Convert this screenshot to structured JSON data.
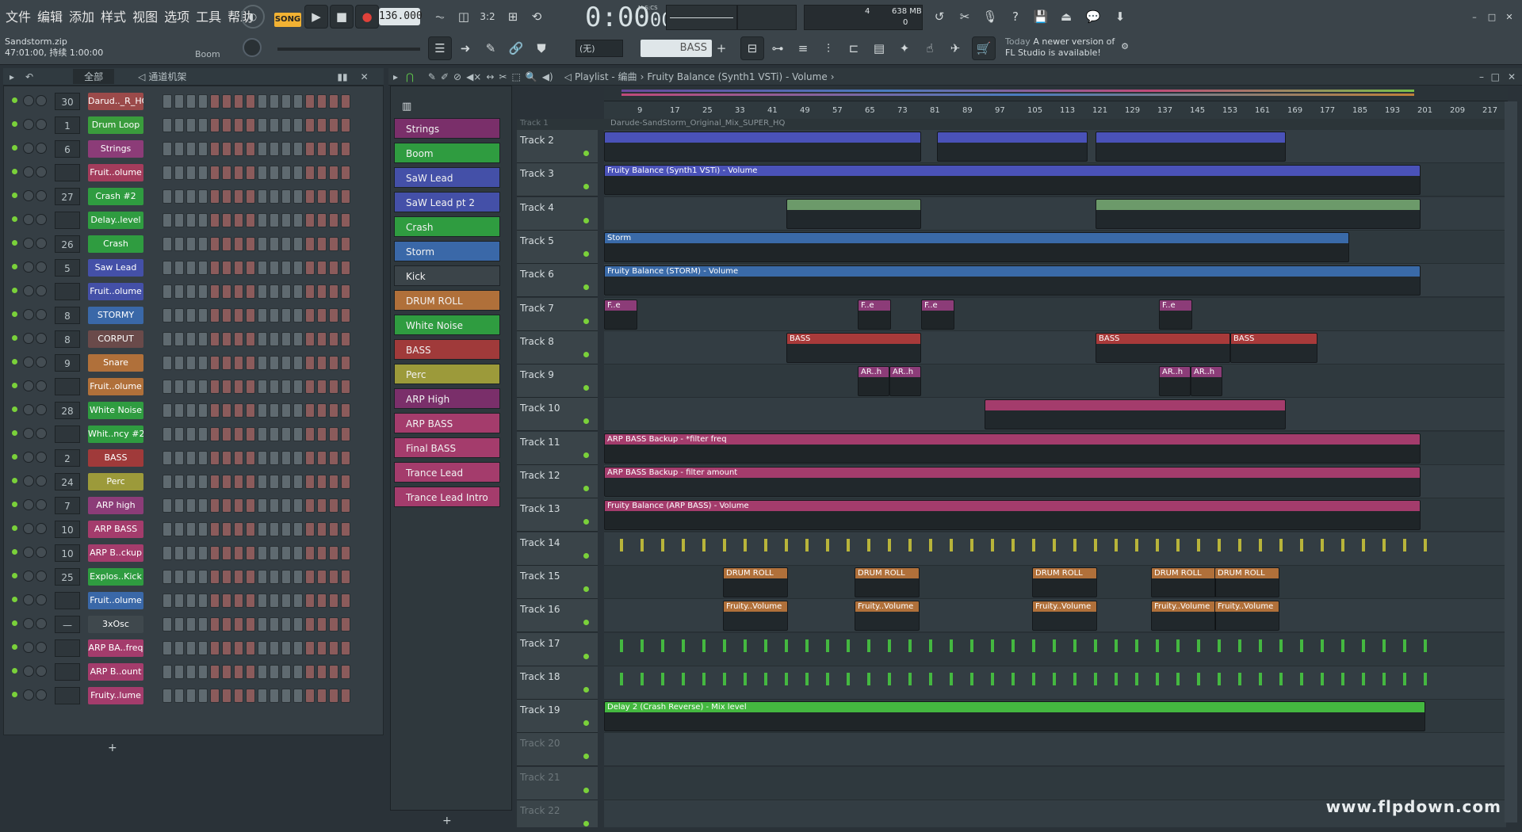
{
  "menu": [
    "文件",
    "编辑",
    "添加",
    "样式",
    "视图",
    "选项",
    "工具",
    "帮助"
  ],
  "transport": {
    "mode": "SONG",
    "tempo": "136.000",
    "time": "0:00",
    "time_sub": "00",
    "mscs": "M:S:CS",
    "memory": "638 MB",
    "cpu": "4",
    "poly": "0"
  },
  "project": {
    "file": "Sandstorm.zip",
    "info": "47:01:00, 持续 1:00:00",
    "hint": "Boom"
  },
  "toolbar2": {
    "pattern": "BASS",
    "snap": "(无)"
  },
  "news": {
    "label": "Today",
    "text1": "A newer version of",
    "text2": "FL Studio is available!"
  },
  "rack": {
    "filter": "全部",
    "title": "通道机架"
  },
  "channels": [
    {
      "num": "30",
      "name": "Darud.._R_HQ",
      "color": "#9b4a4a"
    },
    {
      "num": "1",
      "name": "Drum Loop",
      "color": "#3a9c3c"
    },
    {
      "num": "6",
      "name": "Strings",
      "color": "#8c3c78"
    },
    {
      "num": "",
      "name": "Fruit..olume",
      "color": "#a43c5c"
    },
    {
      "num": "27",
      "name": "Crash #2",
      "color": "#2f9c40"
    },
    {
      "num": "",
      "name": "Delay..level",
      "color": "#2f9c40"
    },
    {
      "num": "26",
      "name": "Crash",
      "color": "#2f9c40"
    },
    {
      "num": "5",
      "name": "Saw Lead",
      "color": "#4450a8"
    },
    {
      "num": "",
      "name": "Fruit..olume",
      "color": "#4450a8"
    },
    {
      "num": "8",
      "name": "STORMY",
      "color": "#3a68a8"
    },
    {
      "num": "8",
      "name": "CORPUT",
      "color": "#6a4a4a"
    },
    {
      "num": "9",
      "name": "Snare",
      "color": "#b0703a"
    },
    {
      "num": "",
      "name": "Fruit..olume",
      "color": "#b0703a"
    },
    {
      "num": "28",
      "name": "White Noise",
      "color": "#2f9c40"
    },
    {
      "num": "",
      "name": "Whit..ncy #2",
      "color": "#2f9c40"
    },
    {
      "num": "2",
      "name": "BASS",
      "color": "#a03a3a"
    },
    {
      "num": "24",
      "name": "Perc",
      "color": "#9c9a3a"
    },
    {
      "num": "7",
      "name": "ARP high",
      "color": "#8c3c78"
    },
    {
      "num": "10",
      "name": "ARP BASS",
      "color": "#a43c6c"
    },
    {
      "num": "10",
      "name": "ARP B..ckup",
      "color": "#a43c6c"
    },
    {
      "num": "25",
      "name": "Explos..Kick",
      "color": "#2f9c40"
    },
    {
      "num": "",
      "name": "Fruit..olume",
      "color": "#3a68a8"
    },
    {
      "num": "—",
      "name": "3xOsc",
      "color": "#3f484d"
    },
    {
      "num": "",
      "name": "ARP BA..freq",
      "color": "#a43c6c"
    },
    {
      "num": "",
      "name": "ARP B..ount",
      "color": "#a43c6c"
    },
    {
      "num": "",
      "name": "Fruity..lume",
      "color": "#a43c6c"
    }
  ],
  "patterns": [
    {
      "name": "Strings",
      "color": "#7a2f6a"
    },
    {
      "name": "Boom",
      "color": "#2f9c40"
    },
    {
      "name": "SaW Lead",
      "color": "#4450a8"
    },
    {
      "name": "SaW Lead pt 2",
      "color": "#4450a8"
    },
    {
      "name": "Crash",
      "color": "#2f9c40"
    },
    {
      "name": "Storm",
      "color": "#3a68a8"
    },
    {
      "name": "Kick",
      "color": "#3b4449"
    },
    {
      "name": "DRUM ROLL",
      "color": "#b0703a"
    },
    {
      "name": "White Noise",
      "color": "#2f9c40"
    },
    {
      "name": "BASS",
      "color": "#a03a3a"
    },
    {
      "name": "Perc",
      "color": "#9c9a3a"
    },
    {
      "name": "ARP High",
      "color": "#7a2f6a"
    },
    {
      "name": "ARP BASS",
      "color": "#a43c6c"
    },
    {
      "name": "Final BASS",
      "color": "#a43c6c"
    },
    {
      "name": "Trance Lead",
      "color": "#a43c6c"
    },
    {
      "name": "Trance Lead Intro",
      "color": "#a43c6c"
    }
  ],
  "playlist": {
    "title": "Playlist - 编曲",
    "path": "Fruity Balance (Synth1 VSTi) - Volume",
    "track1": "Track 1",
    "topclip": "Darude-SandStorm_Original_Mix_SUPER_HQ"
  },
  "ruler": [
    "9",
    "17",
    "25",
    "33",
    "41",
    "49",
    "57",
    "65",
    "73",
    "81",
    "89",
    "97",
    "105",
    "113",
    "121",
    "129",
    "137",
    "145",
    "153",
    "161",
    "169",
    "177",
    "185",
    "193",
    "201",
    "209",
    "217"
  ],
  "tracks": [
    "Track 2",
    "Track 3",
    "Track 4",
    "Track 5",
    "Track 6",
    "Track 7",
    "Track 8",
    "Track 9",
    "Track 10",
    "Track 11",
    "Track 12",
    "Track 13",
    "Track 14",
    "Track 15",
    "Track 16",
    "Track 17",
    "Track 18",
    "Track 19",
    "Track 20",
    "Track 21",
    "Track 22"
  ],
  "clips": {
    "t3": "Fruity Balance (Synth1 VSTi) - Volume",
    "t5": "Storm",
    "t6": "Fruity Balance (STORM) - Volume",
    "t7": "F..e",
    "t8": "BASS",
    "t9": "AR..h",
    "t11": "ARP BASS Backup - *filter freq",
    "t12": "ARP BASS Backup - filter amount",
    "t13": "Fruity Balance (ARP BASS) - Volume",
    "t15": "DRUM ROLL",
    "t16": "Fruity..Volume",
    "t19": "Delay 2 (Crash Reverse) - Mix level"
  },
  "watermark": "www.flpdown.com"
}
